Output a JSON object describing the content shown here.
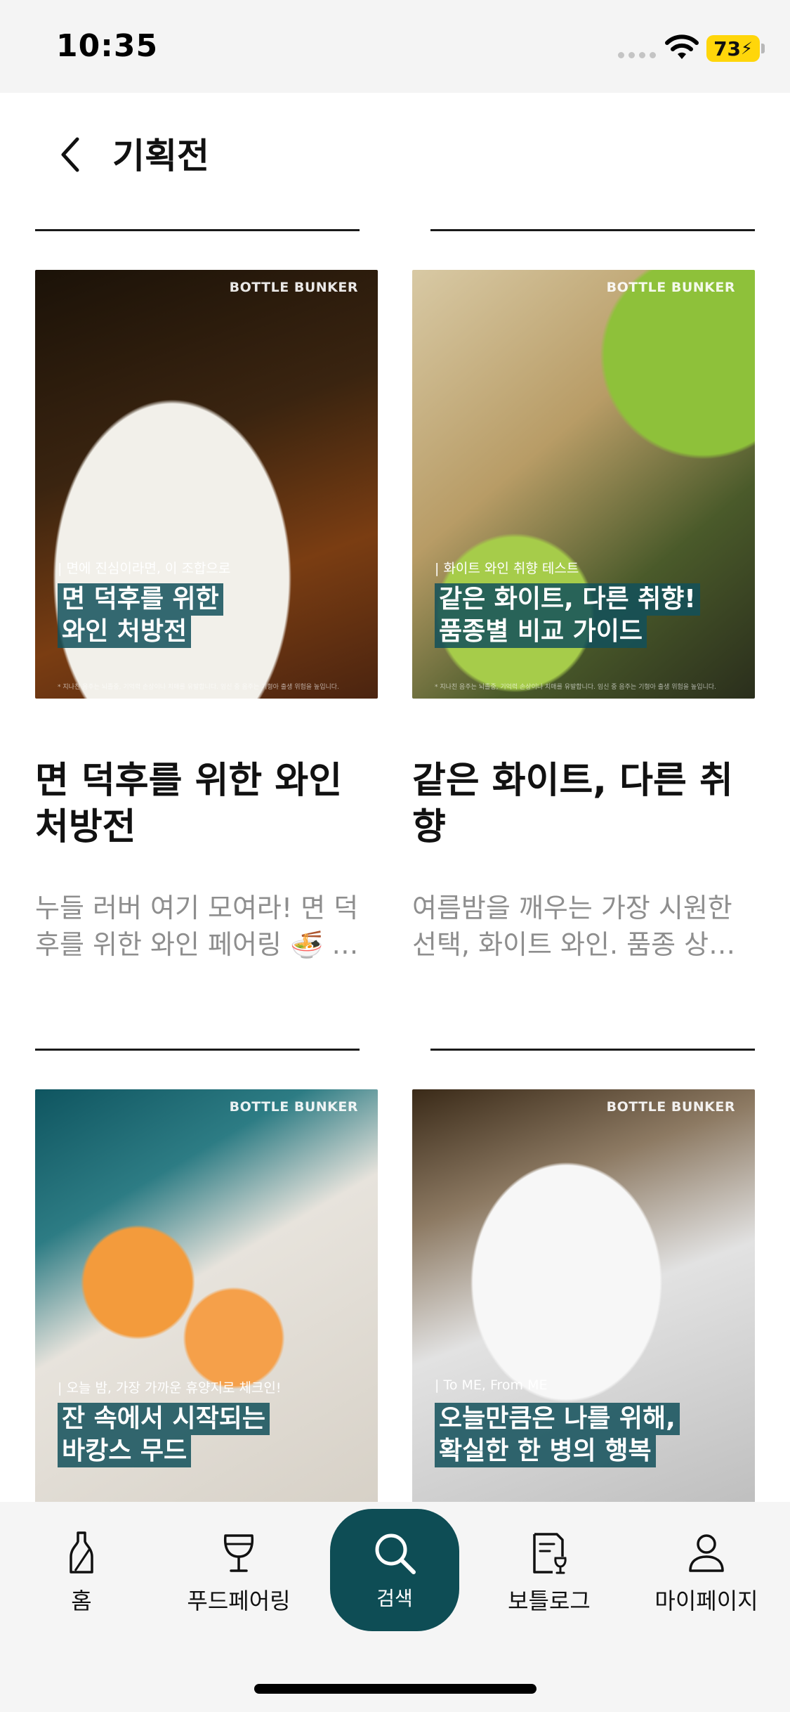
{
  "status_bar": {
    "time": "10:35",
    "battery": "73"
  },
  "header": {
    "title": "기획전"
  },
  "cards": [
    {
      "brand": "BOTTLE BUNKER",
      "kicker": "| 면에 진심이라면, 이 조합으로",
      "headline_1": "면 덕후를 위한",
      "headline_2": "와인 처방전",
      "fine_print": "* 지나친 음주는 뇌졸중, 기억력 손상이나 치매를 유발합니다. 임신 중 음주는 기형아 출생 위험을 높입니다.",
      "title": "면 덕후를 위한 와인 처방전",
      "description": "누들 러버 여기 모여라! 면 덕후를 위한 와인 페어링 🍜 면 요리에 딱 맞는 와인을 골라 드려요."
    },
    {
      "brand": "BOTTLE BUNKER",
      "kicker": "| 화이트 와인 취향 테스트",
      "headline_1": "같은 화이트, 다른 취향!",
      "headline_2": "품종별 비교 가이드",
      "fine_print": "* 지나친 음주는 뇌졸중, 기억력 손상이나 치매를 유발합니다. 임신 중 음주는 기형아 출생 위험을 높입니다.",
      "title": "같은 화이트, 다른 취향",
      "description": "여름밤을 깨우는 가장 시원한 선택, 화이트 와인. 품종 상관없이 즐겨 보세요."
    },
    {
      "brand": "BOTTLE BUNKER",
      "kicker": "| 오늘 밤, 가장 가까운 휴양지로 체크인!",
      "headline_1": "잔 속에서 시작되는",
      "headline_2": "바캉스 무드",
      "fine_print": "",
      "title": "",
      "description": ""
    },
    {
      "brand": "BOTTLE BUNKER",
      "kicker": "| To ME, From ME",
      "headline_1": "오늘만큼은 나를 위해,",
      "headline_2": "확실한 한 병의 행복",
      "fine_print": "",
      "title": "",
      "description": ""
    }
  ],
  "tabs": {
    "home": "홈",
    "food_pairing": "푸드페어링",
    "search": "검색",
    "bottle_log": "보틀로그",
    "my_page": "마이페이지"
  },
  "icons": {
    "back": "chevron-left-icon",
    "home": "wine-bottle-icon",
    "food_pairing": "wine-glass-icon",
    "search": "search-icon",
    "bottle_log": "document-glass-icon",
    "my_page": "person-icon"
  },
  "colors": {
    "accent": "#0e4d55",
    "battery": "#ffd60a"
  }
}
